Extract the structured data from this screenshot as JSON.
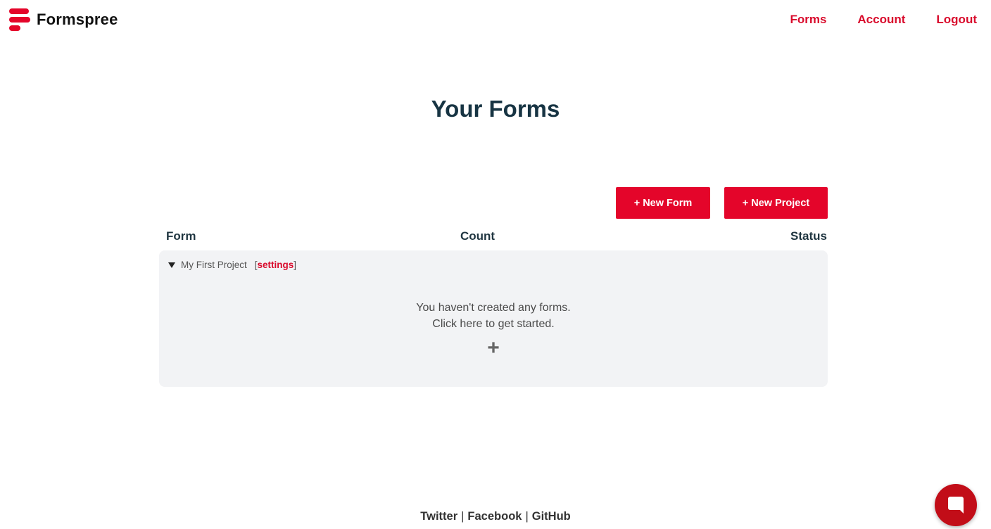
{
  "header": {
    "brand": "Formspree",
    "nav": [
      "Forms",
      "Account",
      "Logout"
    ]
  },
  "main": {
    "title": "Your Forms",
    "buttons": {
      "new_form": "+ New Form",
      "new_project": "+ New Project"
    },
    "table": {
      "columns": [
        "Form",
        "Count",
        "Status"
      ],
      "project": {
        "name": "My First Project",
        "bracket_open": "[",
        "settings": "settings",
        "bracket_close": "]",
        "empty_line1": "You haven't created any forms.",
        "empty_line2": "Click here to get started.",
        "add_symbol": "+"
      }
    }
  },
  "footer": {
    "links": [
      "Twitter",
      "Facebook",
      "GitHub"
    ],
    "separator": "|"
  },
  "colors": {
    "brand": "#e4052a",
    "nav_link": "#d90b2c",
    "panel_bg": "#f2f3f5",
    "chat_widget": "#c20d18"
  },
  "icons": {
    "logo": "formspree-logo-icon",
    "caret": "caret-down-icon",
    "chat": "chat-icon"
  }
}
